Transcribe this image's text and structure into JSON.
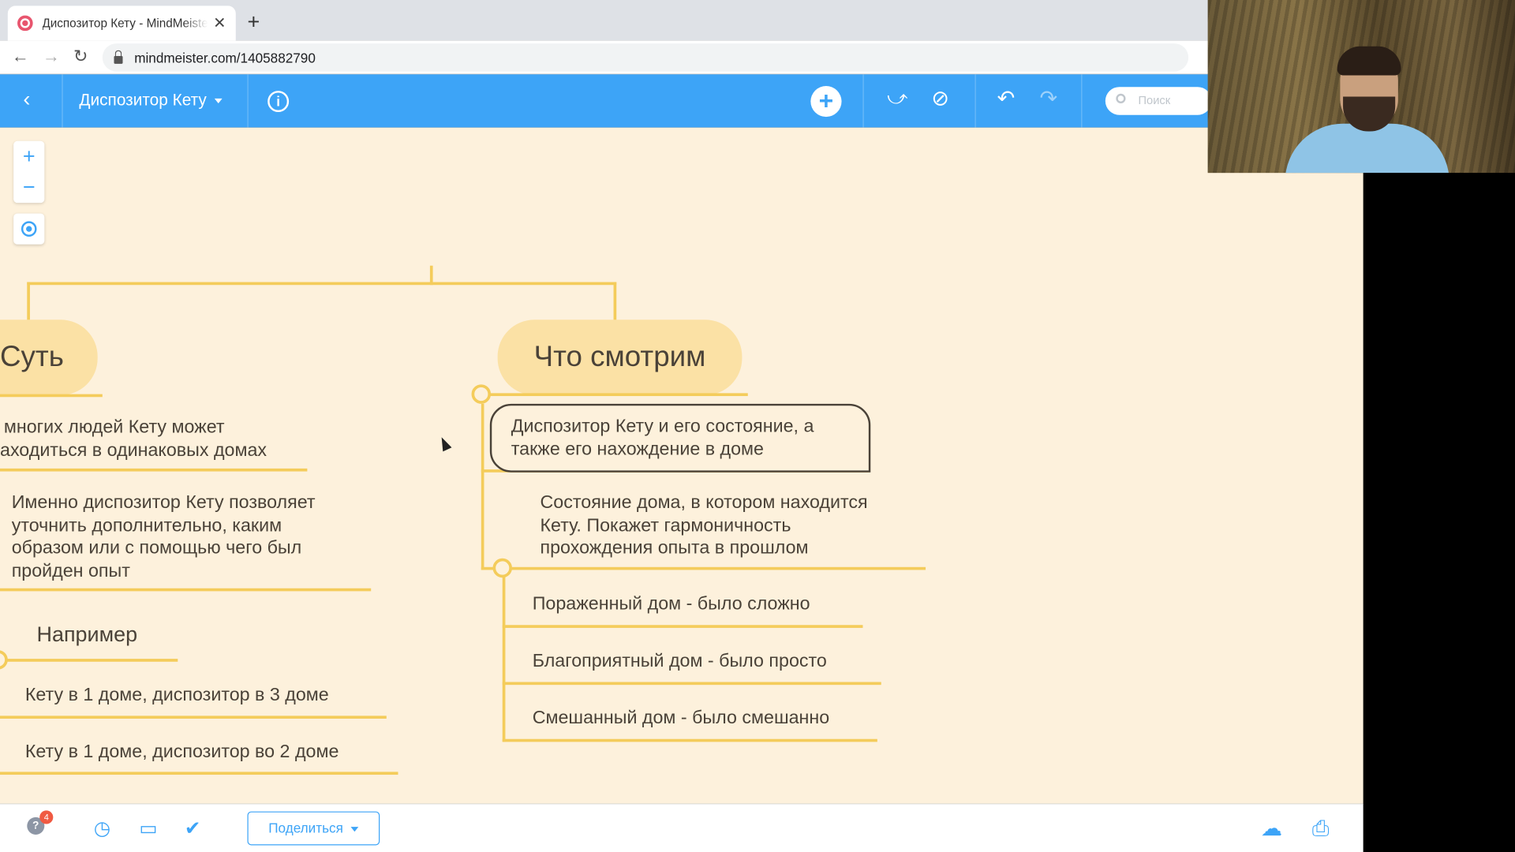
{
  "browser": {
    "tab_title": "Диспозитор Кету - MindMeister",
    "url": "mindmeister.com/1405882790"
  },
  "app": {
    "map_title": "Диспозитор Кету",
    "search_placeholder": "Поиск",
    "share_label": "Поделиться",
    "notification_count": "4",
    "accent_color": "#3da4f7",
    "canvas_color": "#fdf1dc",
    "branch_color": "#f4cc5b"
  },
  "mindmap": {
    "root": "Диспозитор Кету",
    "left_topic": {
      "title": "Суть",
      "items": [
        "многих людей Кету может",
        "аходиться в одинаковых домах"
      ],
      "item2_lines": [
        "Именно диспозитор Кету позволяет",
        "уточнить дополнительно, каким",
        "образом или с помощью чего был",
        "пройден опыт"
      ],
      "example_title": "Например",
      "examples": [
        "Кету в 1 доме, диспозитор в 3 доме",
        "Кету в 1 доме, диспозитор во 2 доме"
      ]
    },
    "right_topic": {
      "title": "Что смотрим",
      "selected_lines": [
        "Диспозитор Кету и его состояние, а",
        "также его нахождение в доме"
      ],
      "house_lines": [
        "Состояние дома, в котором находится",
        "Кету. Покажет гармоничность",
        "прохождения опыта в прошлом"
      ],
      "leaves": [
        "Пораженный дом - было сложно",
        "Благоприятный дом - было просто",
        "Смешанный дом - было смешанно"
      ]
    }
  }
}
